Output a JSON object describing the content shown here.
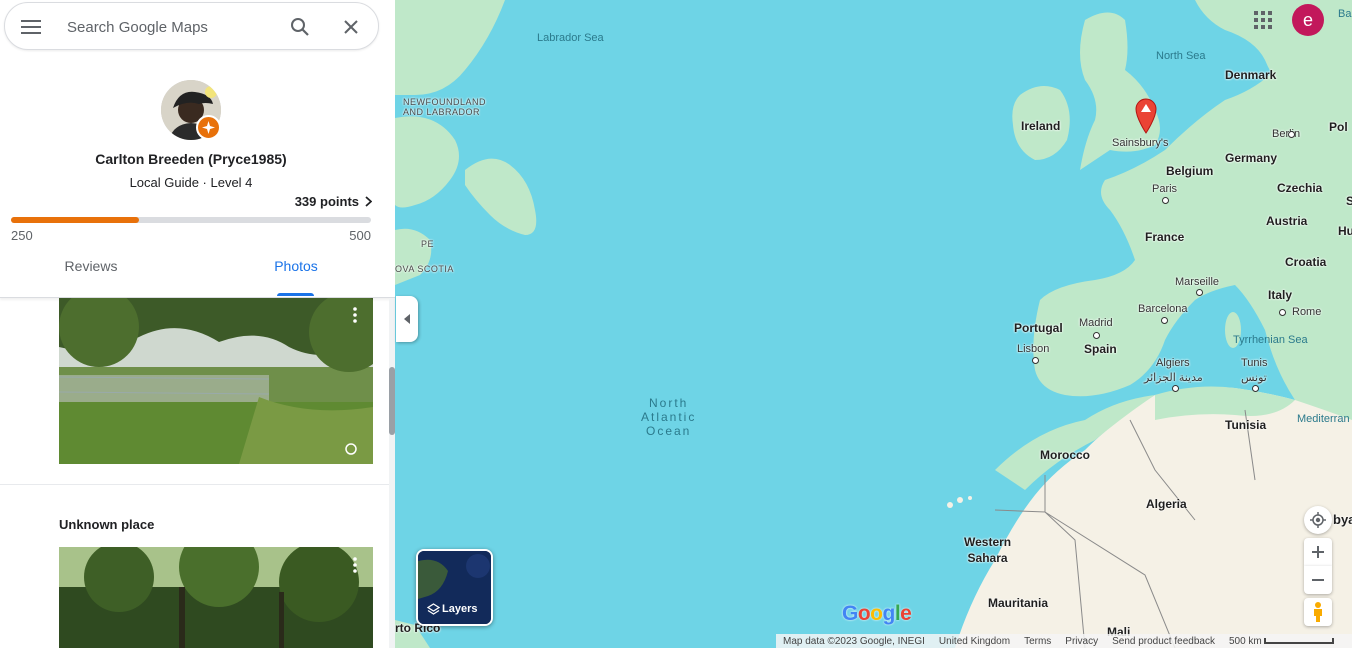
{
  "search": {
    "placeholder": "Search Google Maps"
  },
  "profile": {
    "name": "Carlton Breeden (Pryce1985)",
    "level": "Local Guide · Level 4",
    "points_label": "339 points",
    "progress": {
      "min": "250",
      "max": "500",
      "current": 339
    }
  },
  "tabs": [
    {
      "label": "Reviews",
      "active": false
    },
    {
      "label": "Photos",
      "active": true
    }
  ],
  "photos": {
    "place_label": "Unknown place"
  },
  "map": {
    "labels": {
      "labrador_sea": "Labrador Sea",
      "newfoundland": "NEWFOUNDLAND\nAND LABRADOR",
      "pe": "PE",
      "nova_scotia": "OVA SCOTIA",
      "north_atlantic": "North\nAtlantic\nOcean",
      "north_sea": "North Sea",
      "denmark": "Denmark",
      "ireland": "Ireland",
      "sainsburys": "Sainsbury's",
      "berlin": "Berlin",
      "pol": "Pol",
      "germany": "Germany",
      "belgium": "Belgium",
      "paris": "Paris",
      "czechia": "Czechia",
      "s_edge": "S",
      "austria": "Austria",
      "hu": "Hu",
      "france": "France",
      "croatia": "Croatia",
      "marseille": "Marseille",
      "italy": "Italy",
      "portugal": "Portugal",
      "madrid": "Madrid",
      "barcelona": "Barcelona",
      "rome": "Rome",
      "spain": "Spain",
      "lisbon": "Lisbon",
      "tyrrhenian": "Tyrrhenian Sea",
      "algiers": "Algiers",
      "algiers_ar": "مدينة الجزائر",
      "tunis": "Tunis",
      "tunis_ar": "تونس",
      "mediterranean": "Mediterran",
      "tunisia": "Tunisia",
      "morocco": "Morocco",
      "algeria": "Algeria",
      "western_sahara": "Western\nSahara",
      "mauritania": "Mauritania",
      "mali": "Mali",
      "puerto_rico": "rto Rico",
      "ba": "Ba",
      "bya": "bya"
    },
    "layers_label": "Layers",
    "account_initial": "e",
    "google_logo": "Google",
    "footer": {
      "map_data": "Map data ©2023 Google, INEGI",
      "region": "United Kingdom",
      "terms": "Terms",
      "privacy": "Privacy",
      "feedback": "Send product feedback",
      "scale": "500 km"
    }
  },
  "colors": {
    "accent": "#1a73e8",
    "progress": "#e8710a",
    "water": "#6ed4e6",
    "land": "#bfe8c9",
    "desert": "#f5f1e6",
    "account": "#c2185b",
    "pin": "#ea4335"
  }
}
